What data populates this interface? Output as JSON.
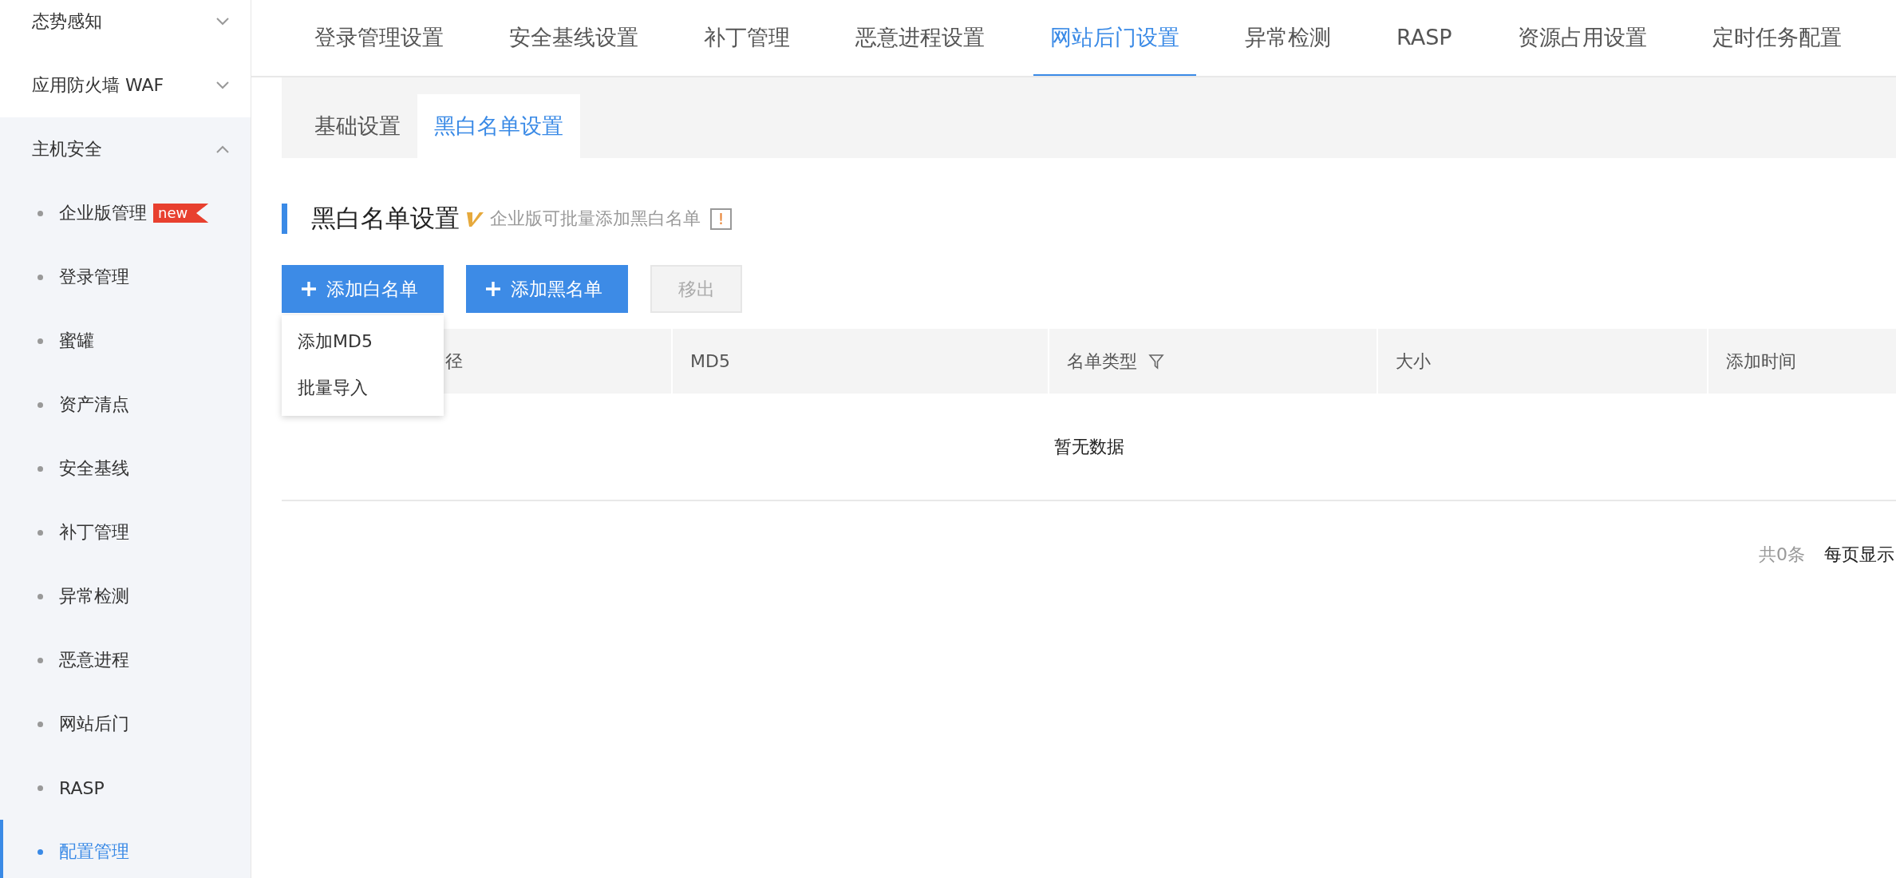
{
  "sidebar": {
    "items": [
      {
        "label": "态势感知",
        "expanded": false
      },
      {
        "label": "应用防火墙 WAF",
        "expanded": false
      },
      {
        "label": "主机安全",
        "expanded": true,
        "children": [
          {
            "label": "企业版管理",
            "selected": false,
            "badge": "new"
          },
          {
            "label": "登录管理",
            "selected": false
          },
          {
            "label": "蜜罐",
            "selected": false
          },
          {
            "label": "资产清点",
            "selected": false
          },
          {
            "label": "安全基线",
            "selected": false
          },
          {
            "label": "补丁管理",
            "selected": false
          },
          {
            "label": "异常检测",
            "selected": false
          },
          {
            "label": "恶意进程",
            "selected": false
          },
          {
            "label": "网站后门",
            "selected": false
          },
          {
            "label": "RASP",
            "selected": false
          },
          {
            "label": "配置管理",
            "selected": true
          }
        ]
      }
    ]
  },
  "tabs": [
    {
      "label": "登录管理设置",
      "selected": false
    },
    {
      "label": "安全基线设置",
      "selected": false
    },
    {
      "label": "补丁管理",
      "selected": false
    },
    {
      "label": "恶意进程设置",
      "selected": false
    },
    {
      "label": "网站后门设置",
      "selected": true
    },
    {
      "label": "异常检测",
      "selected": false
    },
    {
      "label": "RASP",
      "selected": false
    },
    {
      "label": "资源占用设置",
      "selected": false
    },
    {
      "label": "定时任务配置",
      "selected": false
    }
  ],
  "sub_tabs": [
    {
      "label": "基础设置",
      "selected": false
    },
    {
      "label": "黑白名单设置",
      "selected": true
    }
  ],
  "section": {
    "title": "黑白名单设置",
    "note": "企业版可批量添加黑白名单",
    "hint_mark": "!"
  },
  "buttons": [
    {
      "label": "添加白名单",
      "kind": "primary",
      "disabled": false
    },
    {
      "label": "添加黑名单",
      "kind": "primary",
      "disabled": false
    },
    {
      "label": "移出",
      "kind": "plain",
      "disabled": true
    }
  ],
  "dropdown": {
    "items": [
      "添加MD5",
      "批量导入"
    ]
  },
  "table": {
    "columns": [
      {
        "label": "径",
        "filter": false
      },
      {
        "label": "MD5",
        "filter": false
      },
      {
        "label": "名单类型",
        "filter": true
      },
      {
        "label": "大小",
        "filter": false
      },
      {
        "label": "添加时间",
        "filter": false
      }
    ],
    "empty_text": "暂无数据"
  },
  "pagination": {
    "total": "共0条",
    "page_size_label": "每页显示"
  }
}
